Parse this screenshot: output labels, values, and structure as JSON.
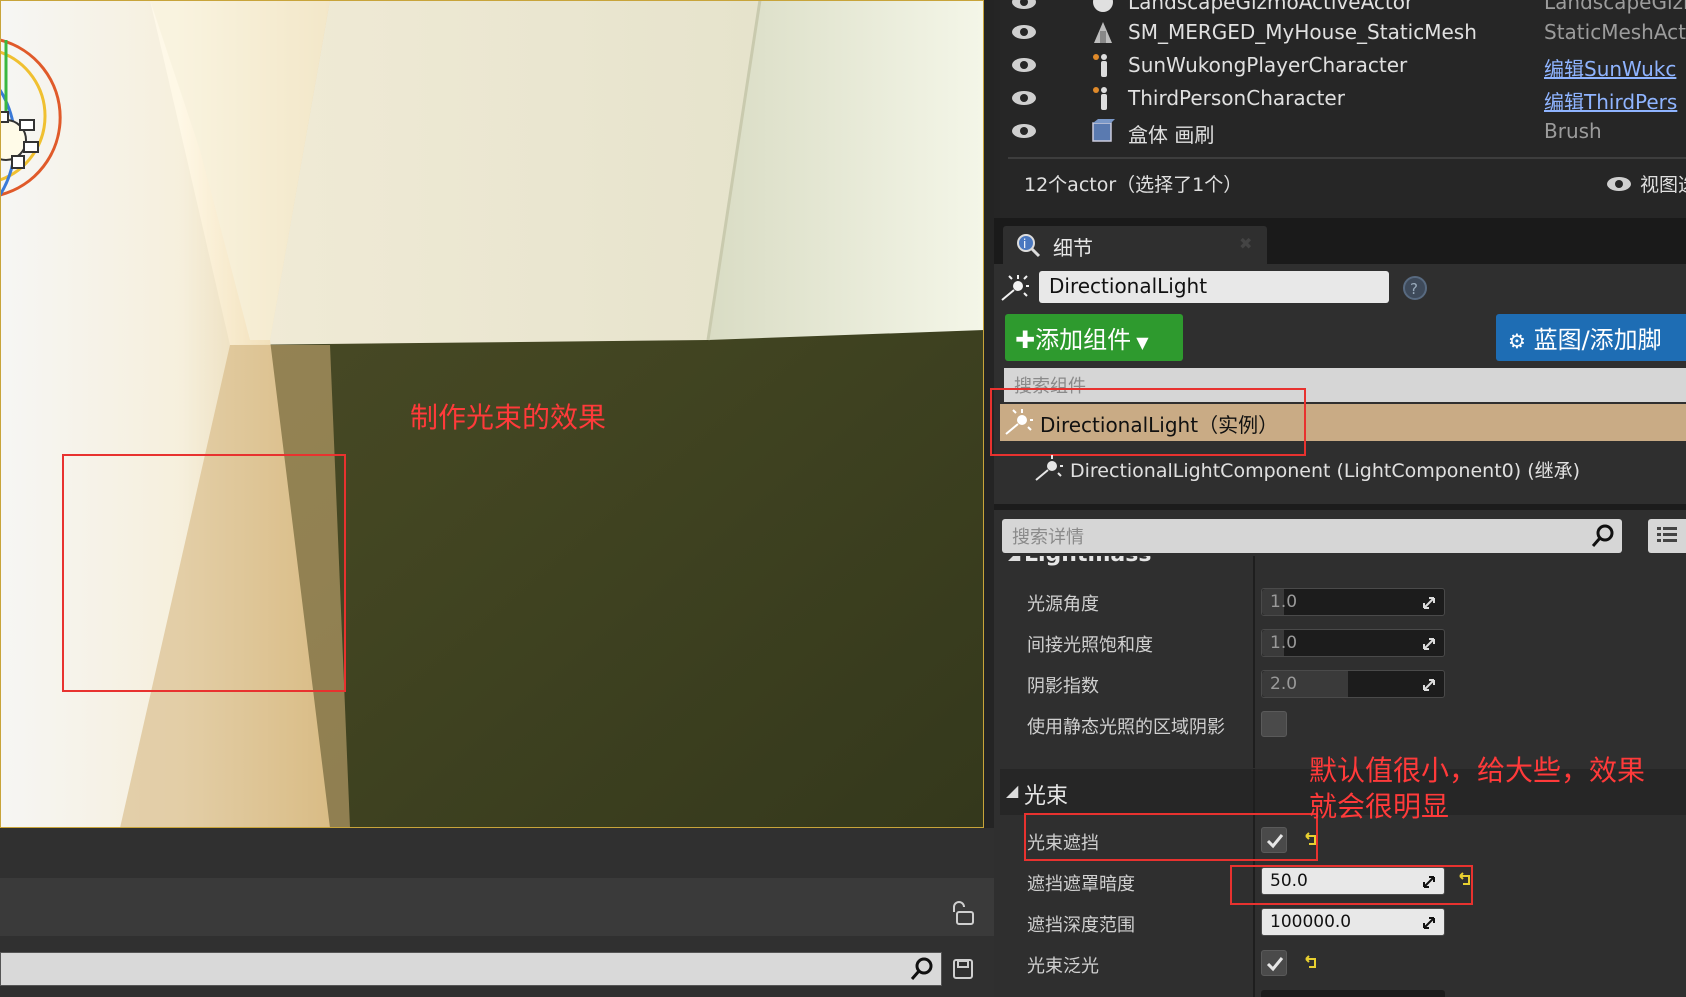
{
  "viewport": {
    "annotation_beam": "制作光束的效果"
  },
  "outliner": {
    "rows": [
      {
        "name": "LandscapeGizmoActiveActor",
        "type": "LandscapeGizi",
        "icon": "sphere-icon",
        "link": false
      },
      {
        "name": "SM_MERGED_MyHouse_StaticMesh",
        "type": "StaticMeshActo",
        "icon": "static-mesh-icon",
        "link": false
      },
      {
        "name": "SunWukongPlayerCharacter",
        "type": "编辑SunWukc",
        "icon": "character-icon",
        "link": true
      },
      {
        "name": "ThirdPersonCharacter",
        "type": "编辑ThirdPers",
        "icon": "character-icon",
        "link": true
      },
      {
        "name": "盒体 画刷",
        "type": "Brush",
        "icon": "brush-box-icon",
        "link": false
      }
    ],
    "status": "12个actor（选择了1个）",
    "view_options": "视图选"
  },
  "details": {
    "tab_label": "细节",
    "actor_name": "DirectionalLight",
    "add_component": "添加组件",
    "blueprint_button": "蓝图/添加脚",
    "search_components_placeholder": "搜索组件",
    "component_root": "DirectionalLight（实例）",
    "component_child": "DirectionalLightComponent (LightComponent0) (继承)",
    "search_details_placeholder": "搜索详情",
    "section_lightmass": "Lightmass",
    "props": [
      {
        "label": "光源角度",
        "value": "1.0",
        "fill": 0.12
      },
      {
        "label": "间接光照饱和度",
        "value": "1.0",
        "fill": 0.12
      },
      {
        "label": "阴影指数",
        "value": "2.0",
        "fill": 0.47
      }
    ],
    "static_shadow_label": "使用静态光照的区域阴影",
    "section_beam": "光束",
    "beam_occlusion_label": "光束遮挡",
    "occlusion_mask_darkness_label": "遮挡遮罩暗度",
    "occlusion_mask_darkness_value": "50.0",
    "occlusion_depth_range_label": "遮挡深度范围",
    "occlusion_depth_range_value": "100000.0",
    "beam_bloom_label": "光束泛光",
    "annotation_line1": "默认值很小，给大些，效果",
    "annotation_line2": "就会很明显"
  },
  "colors": {
    "annotation": "#ff3a3a",
    "add_component_green": "#2e9a2e",
    "blueprint_blue": "#1e6db4",
    "selected_row": "#c9ab85"
  }
}
